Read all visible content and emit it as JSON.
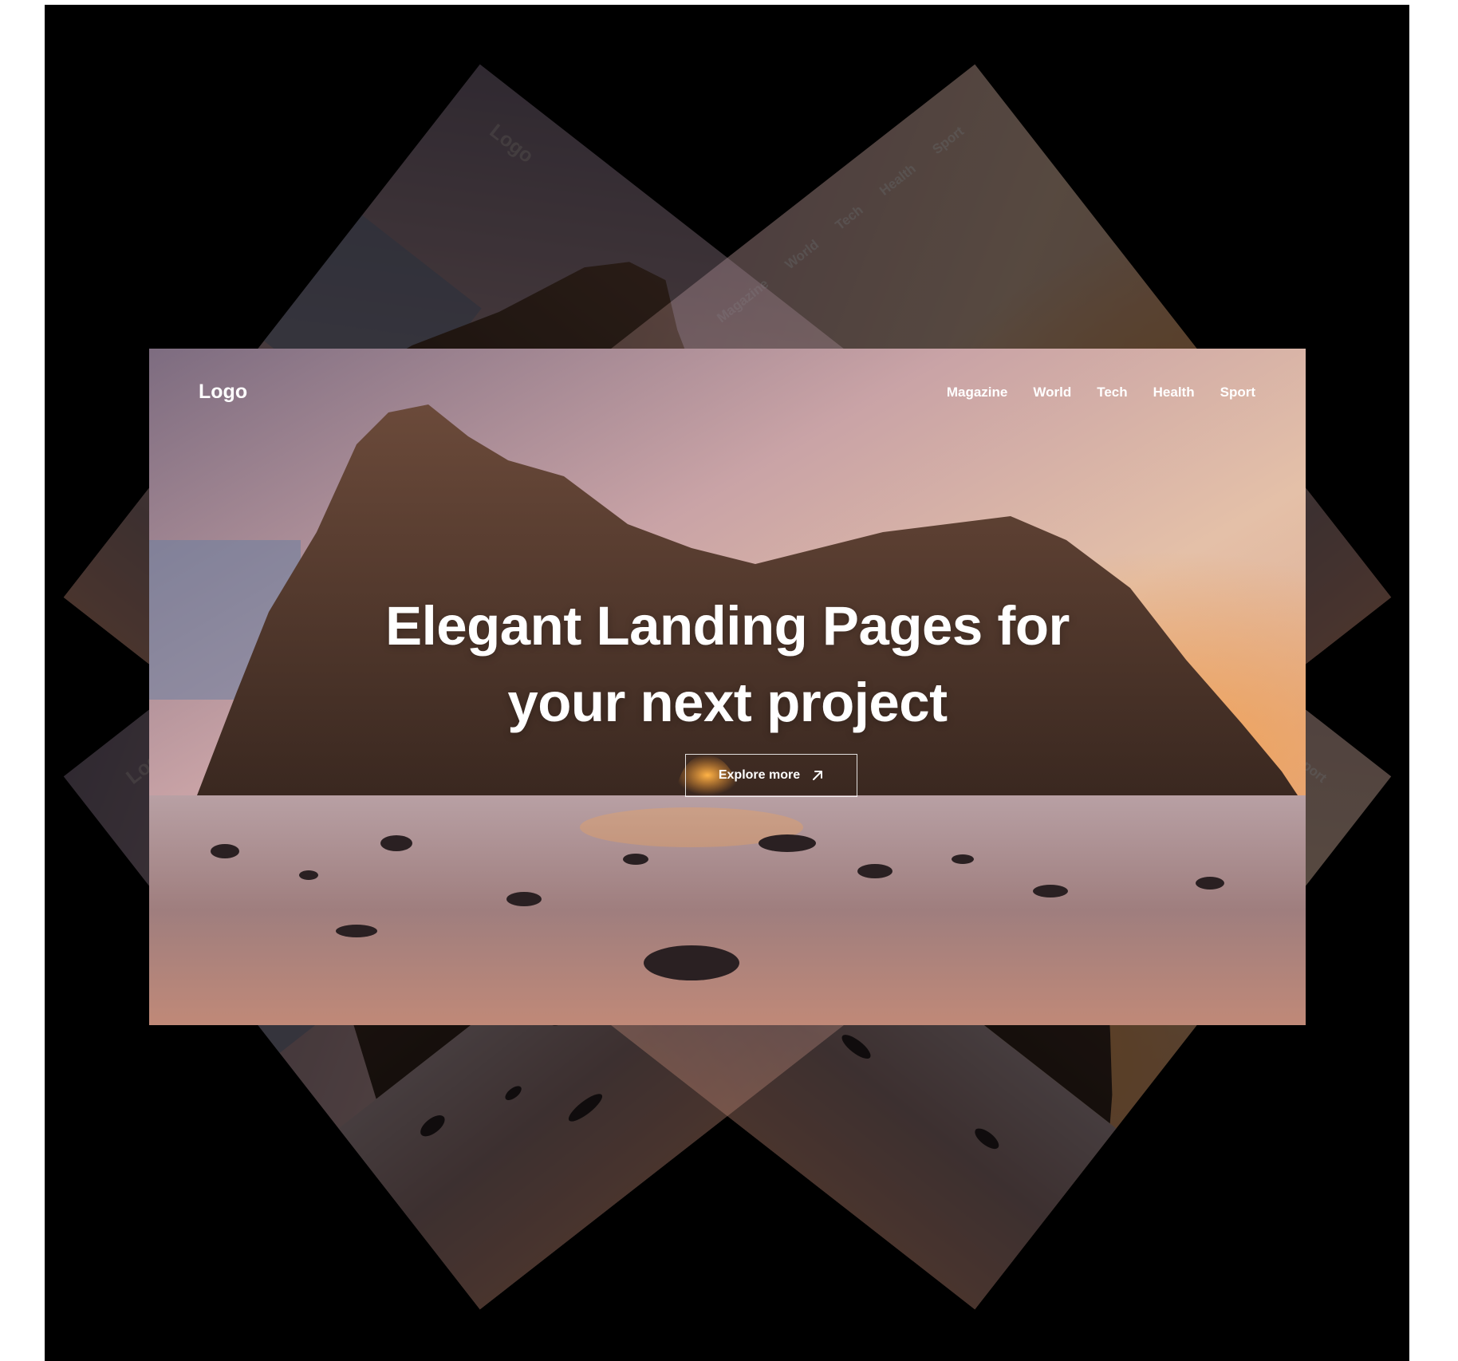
{
  "logo": "Logo",
  "nav": [
    "Magazine",
    "World",
    "Tech",
    "Health",
    "Sport"
  ],
  "hero": {
    "line1": "Elegant Landing Pages for",
    "line2": "your next project"
  },
  "cta": {
    "label": "Explore more",
    "icon": "arrow-up-right-icon"
  },
  "colors": {
    "stage_bg": "#000000",
    "text": "#ffffff"
  }
}
